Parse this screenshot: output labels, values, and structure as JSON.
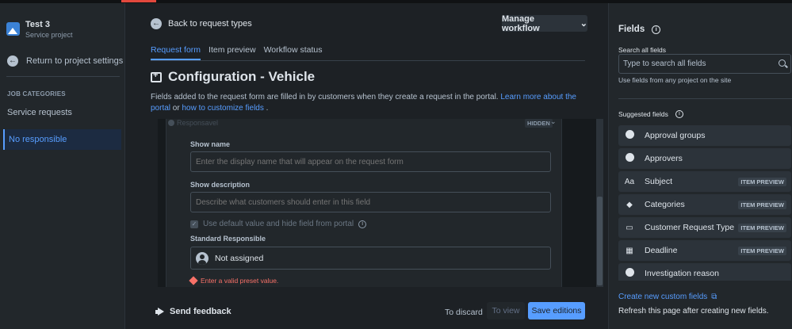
{
  "sidebar": {
    "project_name": "Test 3",
    "project_type": "Service project",
    "back_label": "Return to project settings",
    "section_label": "JOB CATEGORIES",
    "items": [
      {
        "label": "Service requests",
        "selected": false
      },
      {
        "label": "No responsible",
        "selected": true
      }
    ]
  },
  "header": {
    "back_label": "Back to request types",
    "manage_label": "Manage workflow"
  },
  "tabs": [
    {
      "label": "Request form",
      "active": true
    },
    {
      "label": "Item preview",
      "active": false
    },
    {
      "label": "Workflow status",
      "active": false
    }
  ],
  "page": {
    "title": "Configuration - Vehicle",
    "desc_text": "Fields added to the request form are filled in by customers when they create a request in the portal. ",
    "desc_link1": "Learn more about the portal",
    "desc_or": " or ",
    "desc_link2": "how to customize fields",
    "desc_end": " ."
  },
  "form": {
    "field_title": "Responsavel",
    "hidden_badge": "HIDDEN",
    "show_name_label": "Show name",
    "show_name_placeholder": "Enter the display name that will appear on the request form",
    "show_desc_label": "Show description",
    "show_desc_placeholder": "Describe what customers should enter in this field",
    "checkbox_label": "Use default value and hide field from portal",
    "checkbox_checked": true,
    "standard_label": "Standard Responsible",
    "standard_value": "Not assigned",
    "error_text": "Enter a valid preset value."
  },
  "footer": {
    "feedback_label": "Send feedback",
    "discard_label": "To discard",
    "view_label": "To view",
    "save_label": "Save editions"
  },
  "rpanel": {
    "title": "Fields",
    "search_label": "Search all fields",
    "search_placeholder": "Type to search all fields",
    "hint": "Use fields from any project on the site",
    "suggested_label": "Suggested fields",
    "items": [
      {
        "label": "Approval groups",
        "icon": "chevron-circle-icon",
        "badge": ""
      },
      {
        "label": "Approvers",
        "icon": "person-circle-icon",
        "badge": ""
      },
      {
        "label": "Subject",
        "icon": "text-icon",
        "badge": "ITEM PREVIEW"
      },
      {
        "label": "Categories",
        "icon": "tag-icon",
        "badge": "ITEM PREVIEW"
      },
      {
        "label": "Customer Request Type",
        "icon": "request-type-icon",
        "badge": "ITEM PREVIEW"
      },
      {
        "label": "Deadline",
        "icon": "calendar-icon",
        "badge": "ITEM PREVIEW"
      },
      {
        "label": "Investigation reason",
        "icon": "chevron-circle-icon",
        "badge": ""
      }
    ],
    "create_label": "Create new custom fields",
    "refresh_text": "Refresh this page after creating new fields."
  },
  "colors": {
    "accent": "#579dff",
    "background": "#1d2125",
    "error": "#f87168"
  }
}
